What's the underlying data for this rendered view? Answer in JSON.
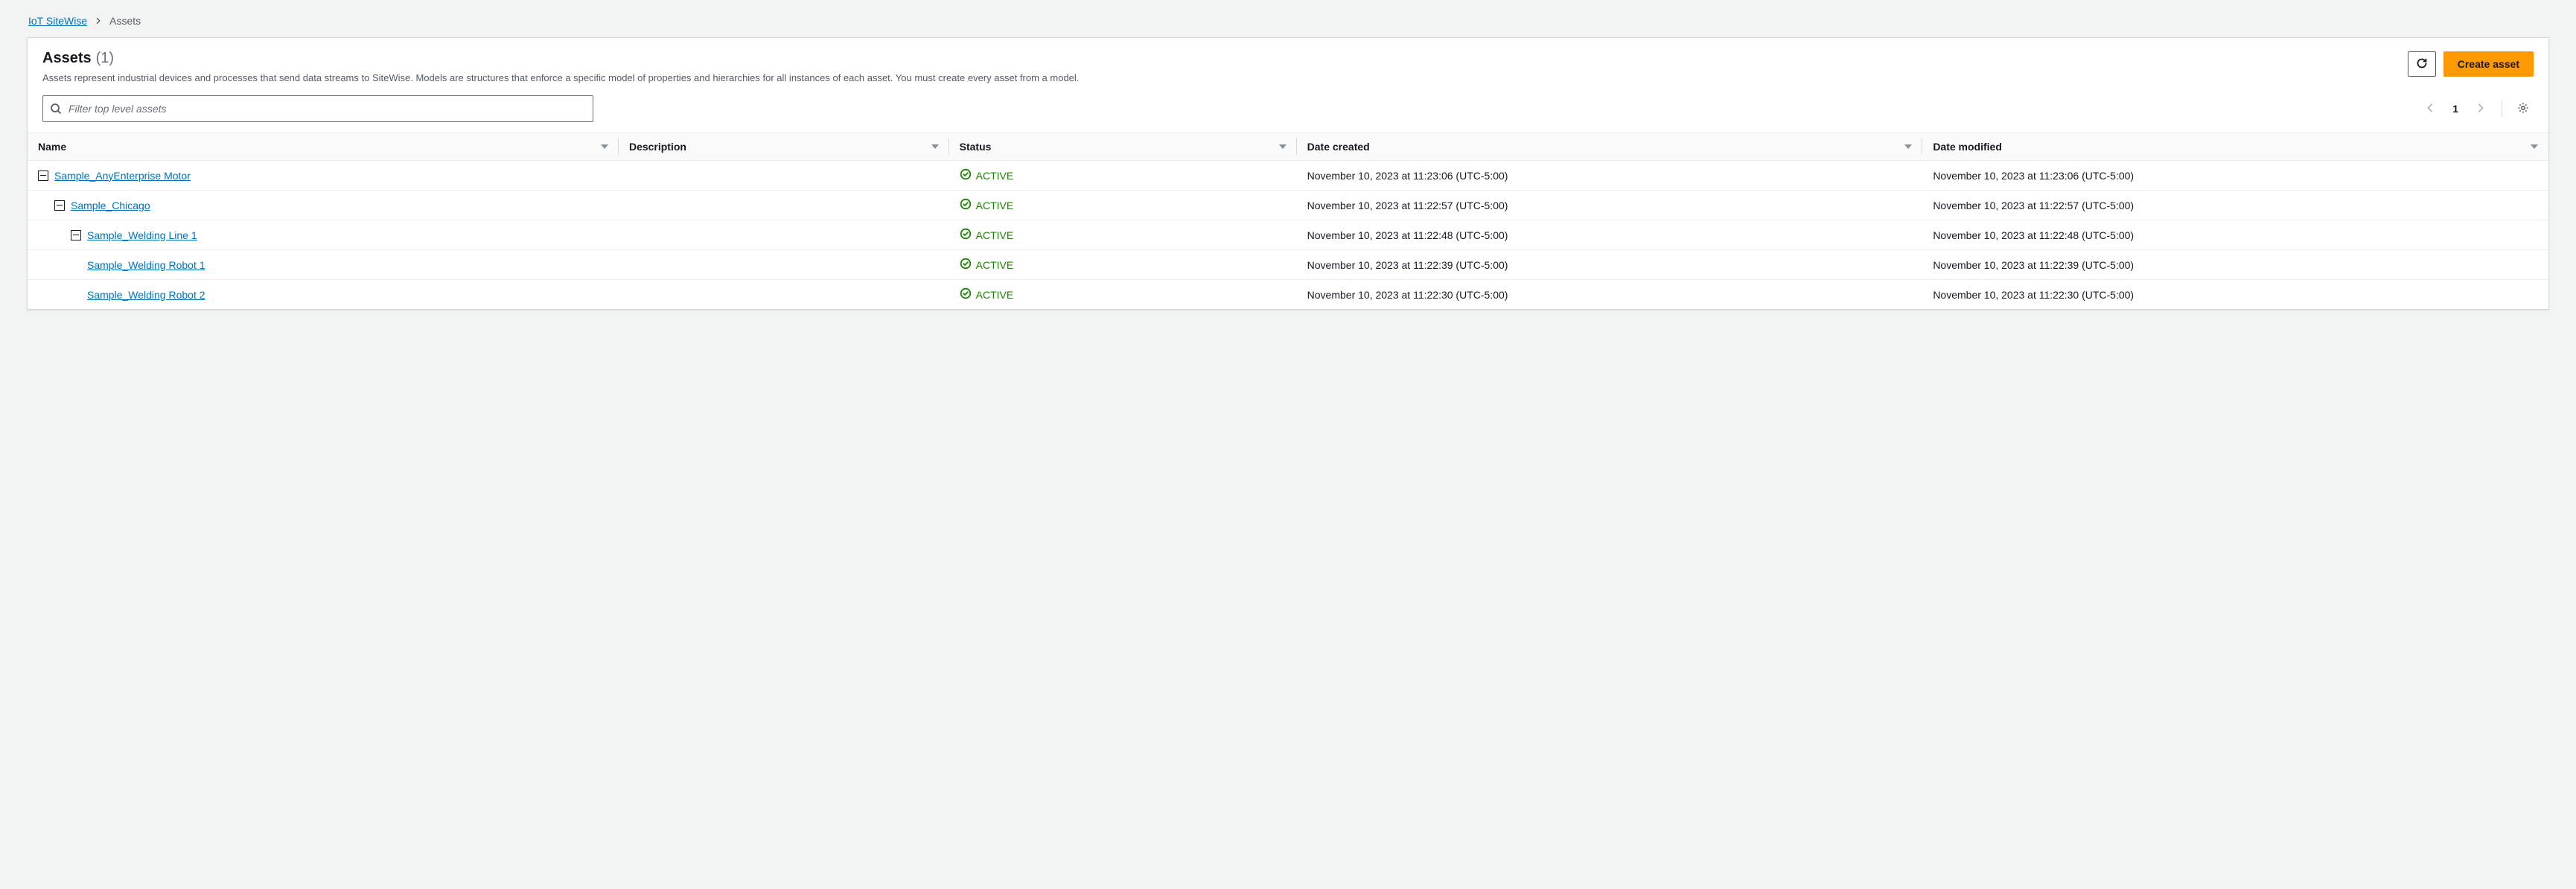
{
  "breadcrumb": {
    "root": "IoT SiteWise",
    "current": "Assets"
  },
  "header": {
    "title": "Assets",
    "count": "(1)",
    "subtitle": "Assets represent industrial devices and processes that send data streams to SiteWise. Models are structures that enforce a specific model of properties and hierarchies for all instances of each asset. You must create every asset from a model.",
    "create_label": "Create asset"
  },
  "filter": {
    "placeholder": "Filter top level assets"
  },
  "pagination": {
    "page": "1"
  },
  "columns": {
    "name": "Name",
    "description": "Description",
    "status": "Status",
    "date_created": "Date created",
    "date_modified": "Date modified"
  },
  "status_label": "ACTIVE",
  "rows": [
    {
      "indent": 0,
      "expandable": true,
      "name": "Sample_AnyEnterprise Motor",
      "description": "",
      "status": "ACTIVE",
      "date_created": "November 10, 2023 at 11:23:06 (UTC-5:00)",
      "date_modified": "November 10, 2023 at 11:23:06 (UTC-5:00)"
    },
    {
      "indent": 1,
      "expandable": true,
      "name": "Sample_Chicago",
      "description": "",
      "status": "ACTIVE",
      "date_created": "November 10, 2023 at 11:22:57 (UTC-5:00)",
      "date_modified": "November 10, 2023 at 11:22:57 (UTC-5:00)"
    },
    {
      "indent": 2,
      "expandable": true,
      "name": "Sample_Welding Line 1",
      "description": "",
      "status": "ACTIVE",
      "date_created": "November 10, 2023 at 11:22:48 (UTC-5:00)",
      "date_modified": "November 10, 2023 at 11:22:48 (UTC-5:00)"
    },
    {
      "indent": 3,
      "expandable": false,
      "name": "Sample_Welding Robot 1",
      "description": "",
      "status": "ACTIVE",
      "date_created": "November 10, 2023 at 11:22:39 (UTC-5:00)",
      "date_modified": "November 10, 2023 at 11:22:39 (UTC-5:00)"
    },
    {
      "indent": 3,
      "expandable": false,
      "name": "Sample_Welding Robot 2",
      "description": "",
      "status": "ACTIVE",
      "date_created": "November 10, 2023 at 11:22:30 (UTC-5:00)",
      "date_modified": "November 10, 2023 at 11:22:30 (UTC-5:00)"
    }
  ]
}
